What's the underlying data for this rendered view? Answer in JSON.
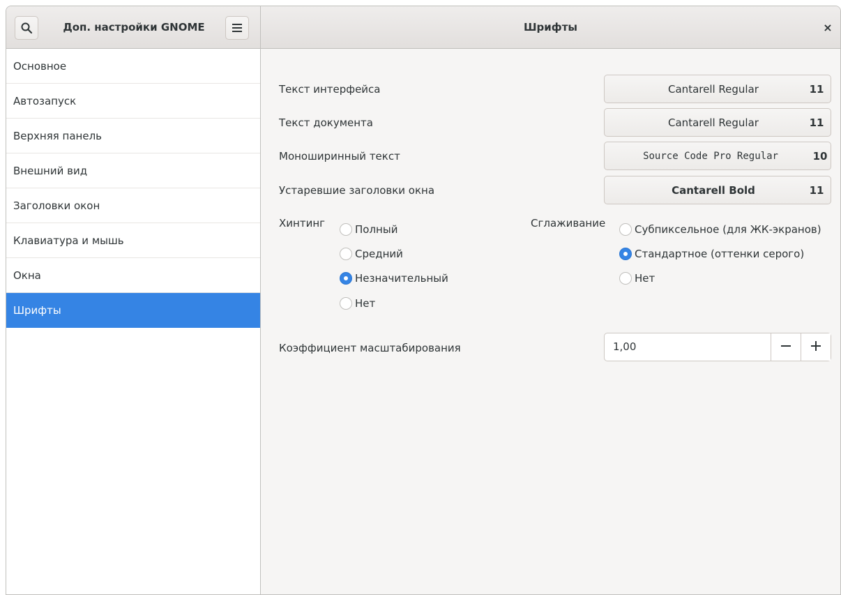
{
  "header": {
    "app_title": "Доп. настройки GNOME",
    "page_title": "Шрифты",
    "close_glyph": "×"
  },
  "sidebar": {
    "items": [
      {
        "label": "Основное"
      },
      {
        "label": "Автозапуск"
      },
      {
        "label": "Верхняя панель"
      },
      {
        "label": "Внешний вид"
      },
      {
        "label": "Заголовки окон"
      },
      {
        "label": "Клавиатура и мышь"
      },
      {
        "label": "Окна"
      },
      {
        "label": "Шрифты",
        "active": true
      }
    ]
  },
  "fonts": {
    "interface": {
      "label": "Текст интерфейса",
      "font": "Cantarell Regular",
      "size": "11"
    },
    "document": {
      "label": "Текст документа",
      "font": "Cantarell Regular",
      "size": "11"
    },
    "monospace": {
      "label": "Моноширинный текст",
      "font": "Source Code Pro Regular",
      "size": "10"
    },
    "titlebar": {
      "label": "Устаревшие заголовки окна",
      "font": "Cantarell Bold",
      "size": "11"
    }
  },
  "hinting": {
    "label": "Хинтинг",
    "options": [
      "Полный",
      "Средний",
      "Незначительный",
      "Нет"
    ],
    "selected": "Незначительный"
  },
  "antialiasing": {
    "label": "Сглаживание",
    "options": [
      "Субпиксельное (для ЖК-экранов)",
      "Стандартное (оттенки серого)",
      "Нет"
    ],
    "selected": "Стандартное (оттенки серого)"
  },
  "scaling": {
    "label": "Коэффициент масштабирования",
    "value": "1,00"
  },
  "colors": {
    "accent": "#3584e4",
    "header_bg": "#e8e6e3",
    "content_bg": "#f6f5f4"
  }
}
